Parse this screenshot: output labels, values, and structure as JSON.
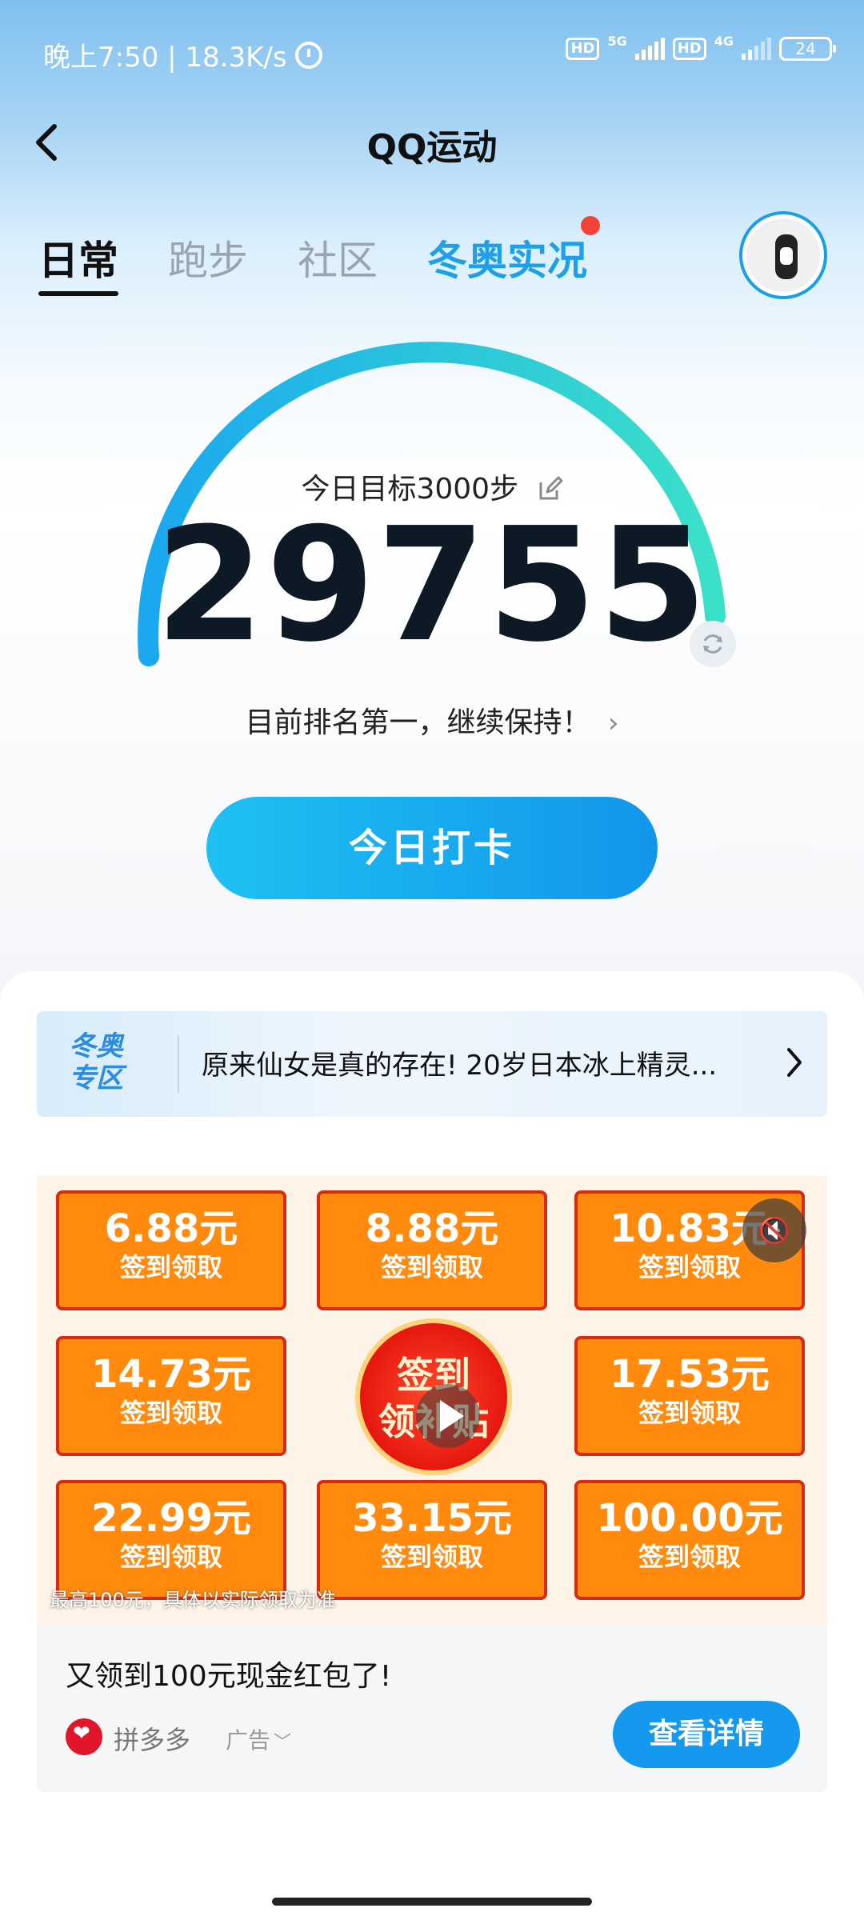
{
  "status_bar": {
    "time_speed": "晚上7:50 | 18.3K/s",
    "sim1_hd": "HD",
    "sim1_net": "5G",
    "sim2_hd": "HD",
    "sim2_net": "4G",
    "battery": "24"
  },
  "header": {
    "title": "QQ运动"
  },
  "tabs": [
    {
      "label": "日常",
      "active": true
    },
    {
      "label": "跑步",
      "active": false
    },
    {
      "label": "社区",
      "active": false
    },
    {
      "label": "冬奥实况",
      "active": false,
      "badge": "red-dot"
    }
  ],
  "progress": {
    "goal_text": "今日目标3000步",
    "steps": "29755",
    "rank_text": "目前排名第一，继续保持！",
    "ring_fraction": 1.0,
    "ring_colors": [
      "#1aa8ef",
      "#3be0c8"
    ]
  },
  "checkin_button": {
    "label": "今日打卡"
  },
  "banner": {
    "logo_line1": "冬奥",
    "logo_line2": "专区",
    "text": "原来仙女是真的存在! 20岁日本冰上精灵..."
  },
  "ad": {
    "tiles": [
      {
        "amount": "6.88元",
        "sub": "签到领取"
      },
      {
        "amount": "8.88元",
        "sub": "签到领取"
      },
      {
        "amount": "10.83元",
        "sub": "签到领取"
      },
      {
        "amount": "14.73元",
        "sub": "签到领取"
      },
      {
        "amount": "17.53元",
        "sub": "签到领取"
      },
      {
        "amount": "22.99元",
        "sub": "签到领取"
      },
      {
        "amount": "33.15元",
        "sub": "签到领取"
      },
      {
        "amount": "100.00元",
        "sub": "签到领取"
      }
    ],
    "center_line1": "签到",
    "center_line2": "领补贴",
    "disclaimer": "最高100元，具体以实际领取为准",
    "title": "又领到100元现金红包了!",
    "advertiser": "拼多多",
    "tag": "广告",
    "detail_button": "查看详情"
  },
  "colors": {
    "accent": "#1499ee",
    "ad_orange": "#ff8a0d",
    "ad_red": "#d62a12"
  }
}
